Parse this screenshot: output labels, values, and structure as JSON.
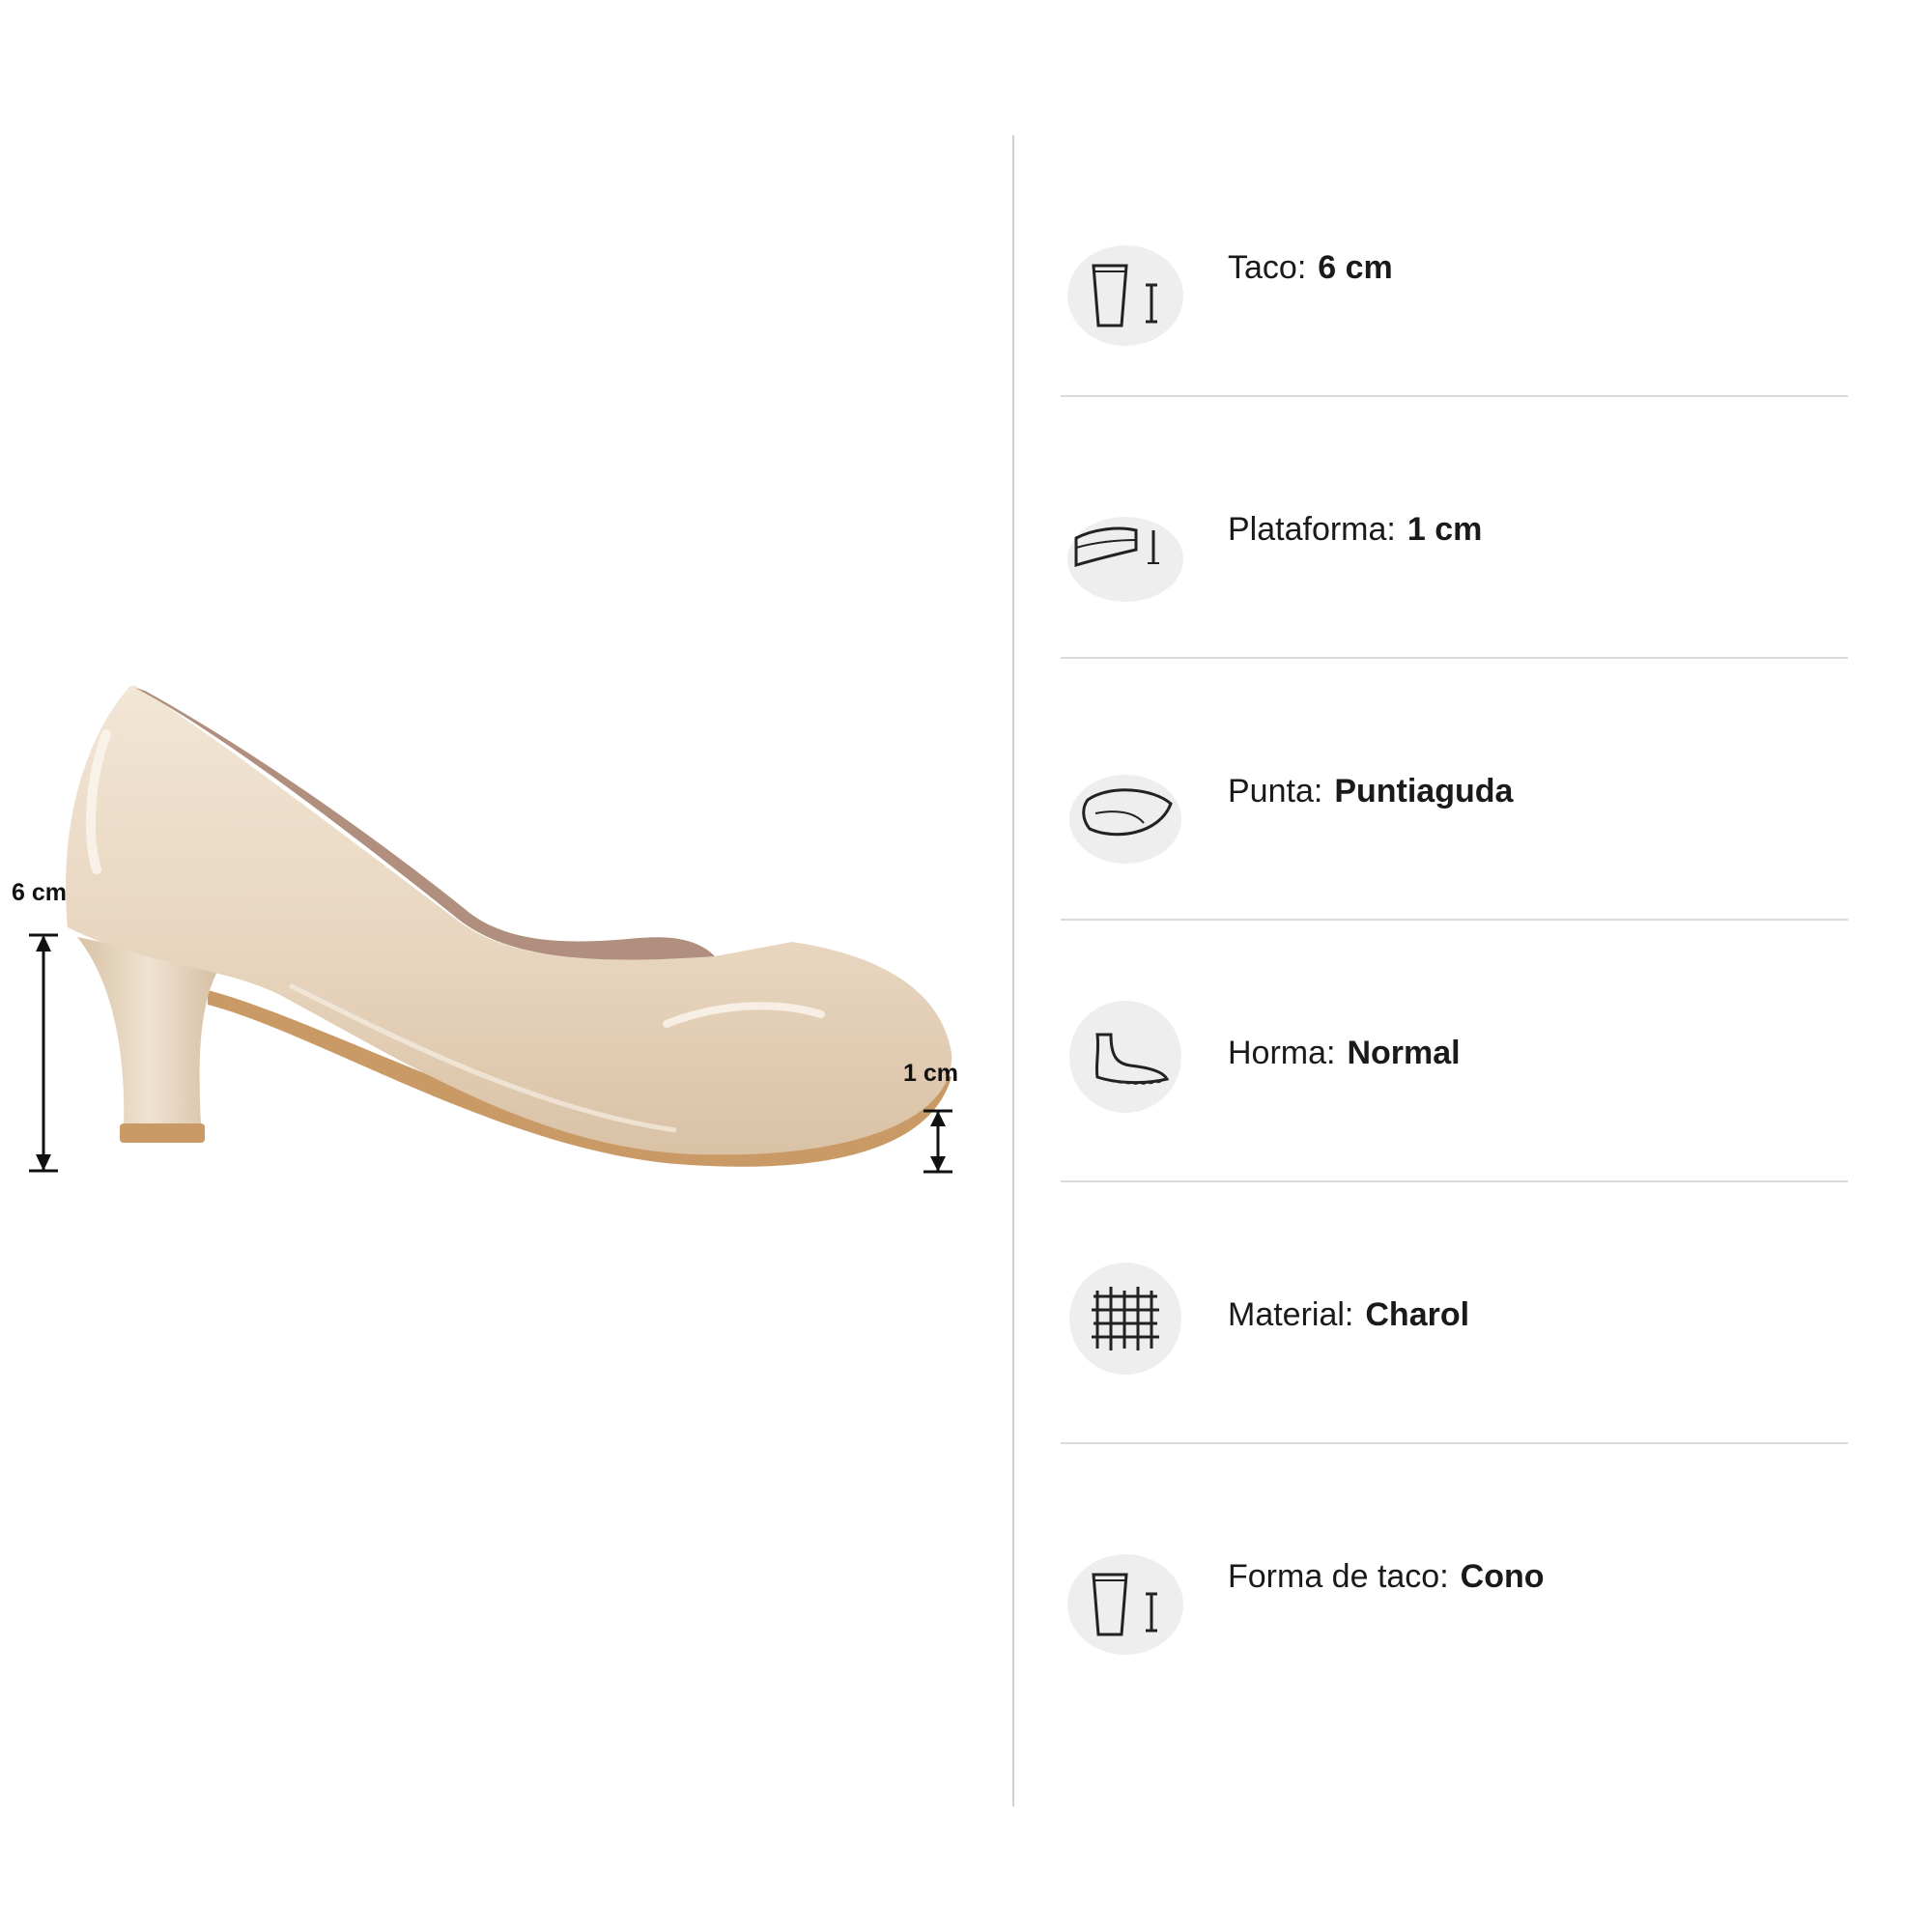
{
  "measurements": {
    "heel_height": "6 cm",
    "platform_height": "1 cm"
  },
  "colors": {
    "shoe": "#ead9c3",
    "lining": "#b08f7e",
    "sole": "#c99a66",
    "divider": "#cfcfcf",
    "icon_bg": "#eeeeee"
  },
  "specs": [
    {
      "label": "Taco:",
      "value": "6 cm",
      "icon": "heel-height-icon"
    },
    {
      "label": "Plataforma:",
      "value": "1 cm",
      "icon": "platform-icon"
    },
    {
      "label": "Punta:",
      "value": "Puntiaguda",
      "icon": "toe-shape-icon"
    },
    {
      "label": "Horma:",
      "value": "Normal",
      "icon": "foot-last-icon"
    },
    {
      "label": "Material:",
      "value": "Charol",
      "icon": "material-weave-icon"
    },
    {
      "label": "Forma de taco:",
      "value": "Cono",
      "icon": "heel-shape-icon"
    }
  ]
}
